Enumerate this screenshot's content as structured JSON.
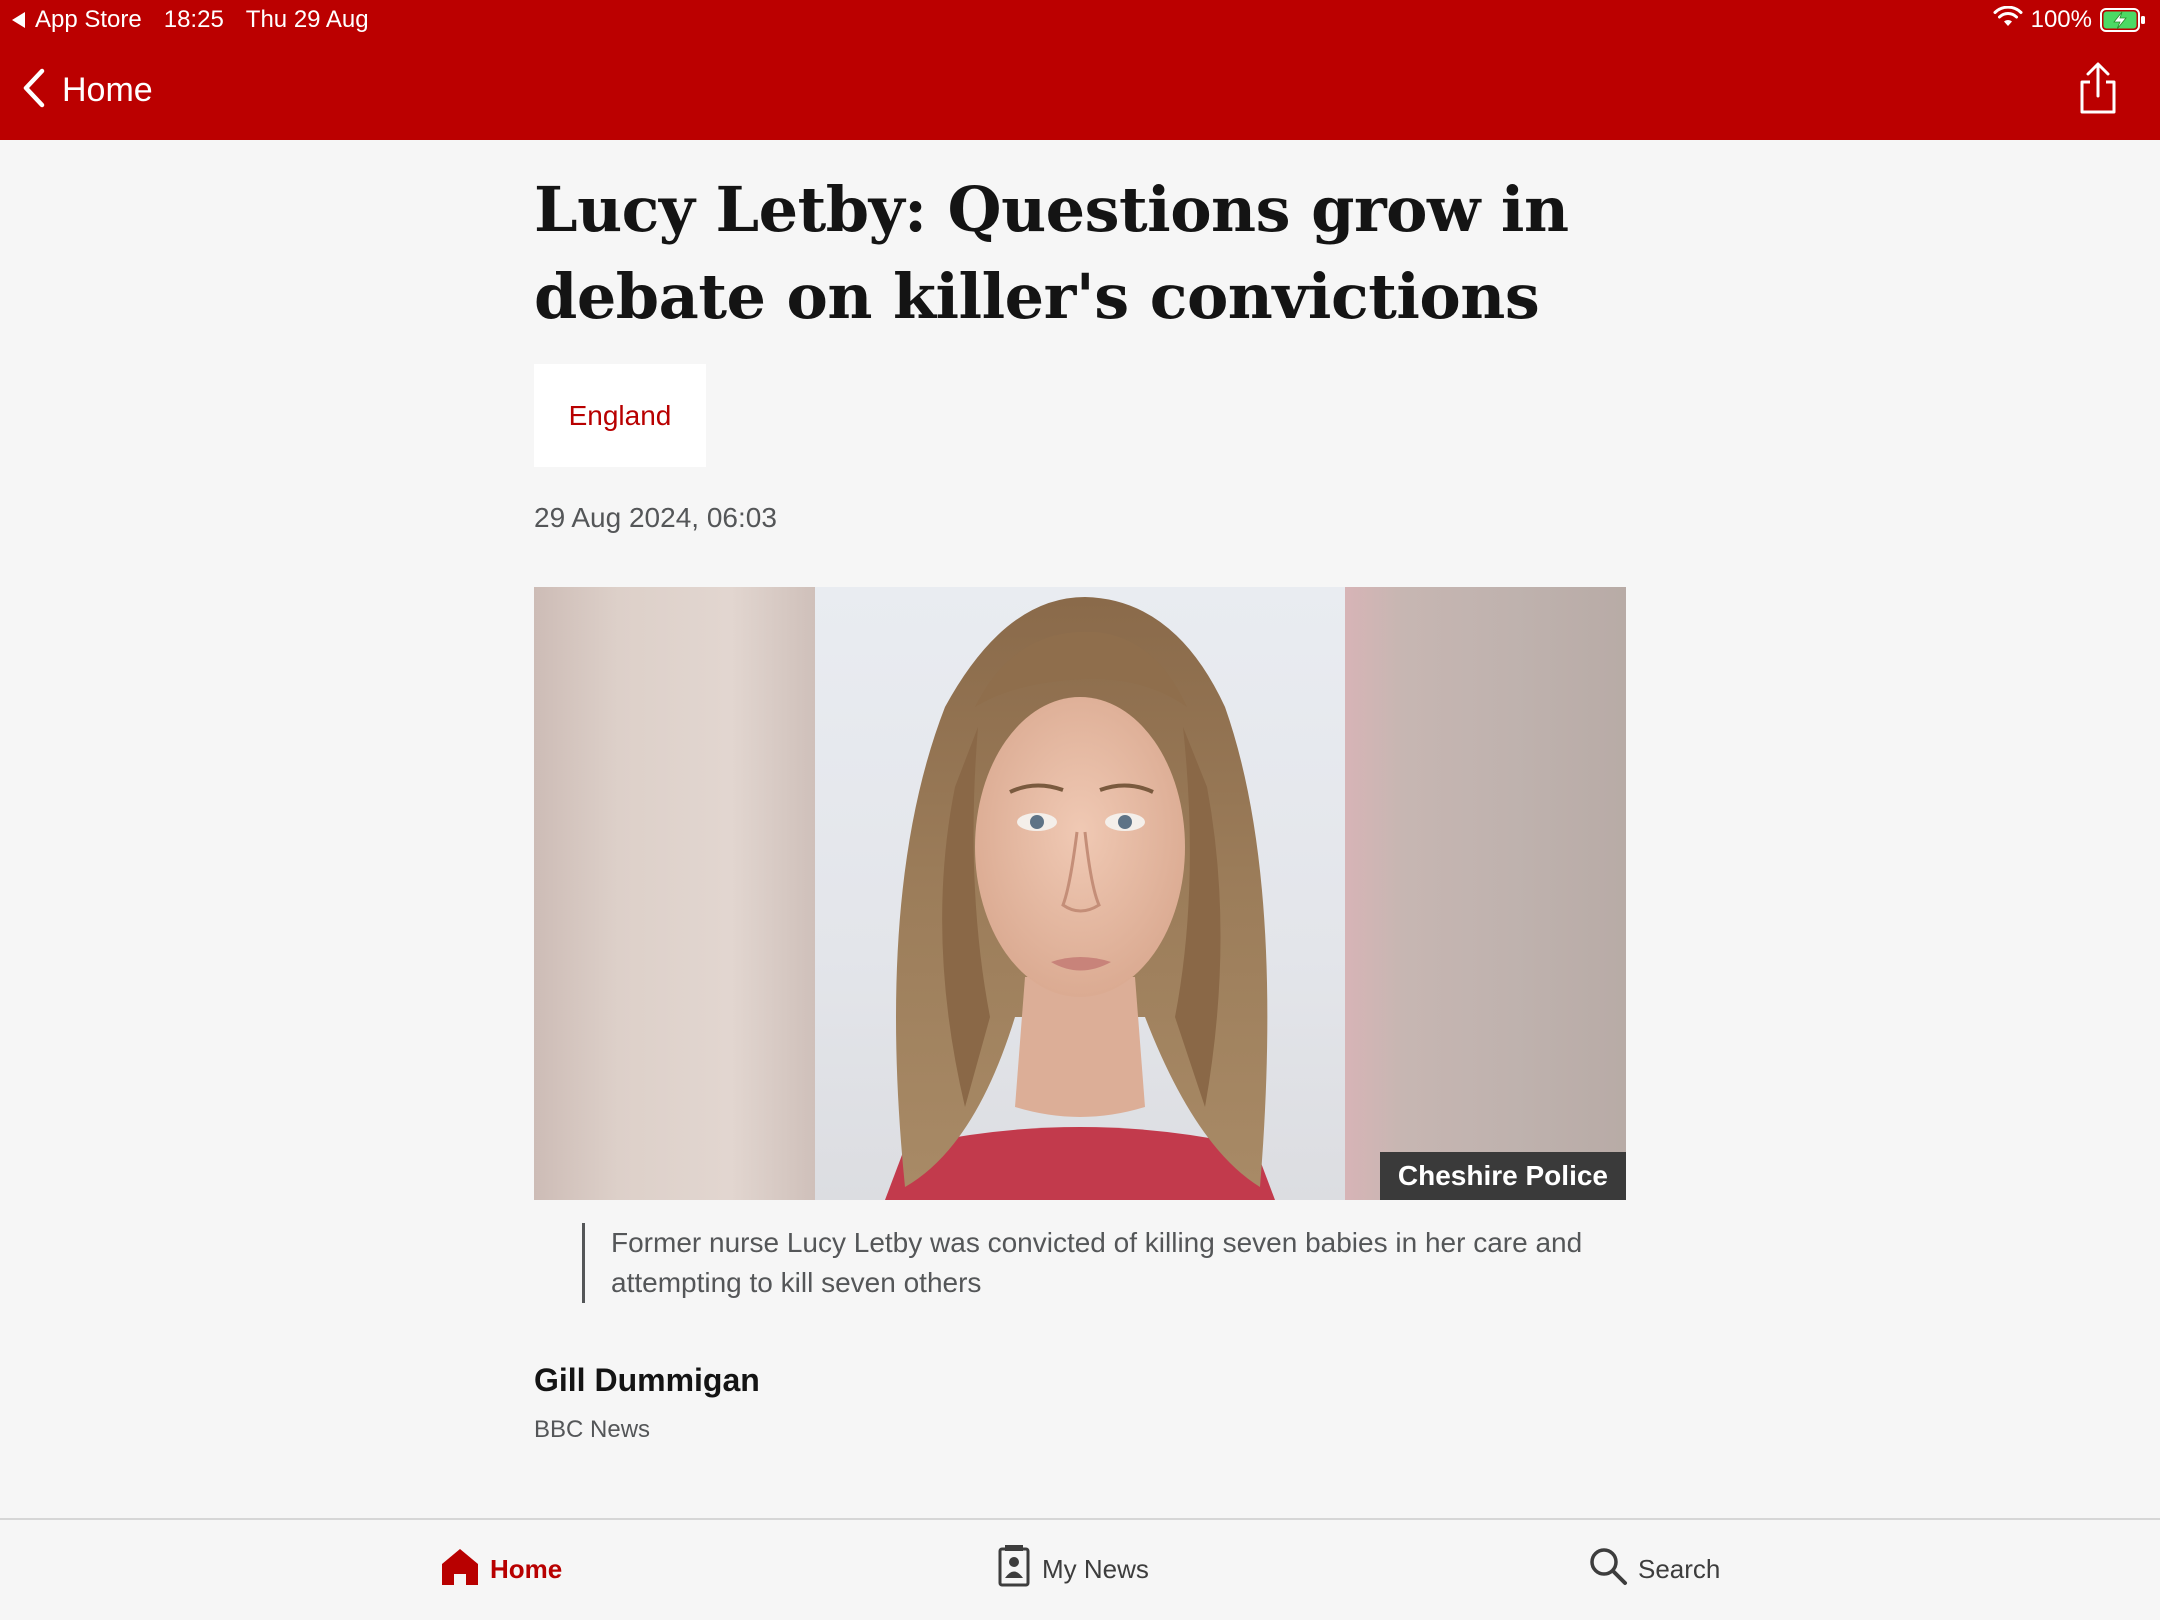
{
  "status_bar": {
    "back_app": "App Store",
    "time": "18:25",
    "date": "Thu 29 Aug",
    "battery_percent": "100%",
    "battery_level": 1.0,
    "charging": true
  },
  "nav": {
    "back_label": "Home",
    "share_icon": "share-icon"
  },
  "article": {
    "headline": "Lucy Letby: Questions grow in debate on killer's convictions",
    "topic": "England",
    "timestamp": "29 Aug 2024, 06:03",
    "image": {
      "credit": "Cheshire Police",
      "caption": "Former nurse Lucy Letby was convicted of killing seven babies in her care and attempting to kill seven others"
    },
    "byline": {
      "author": "Gill Dummigan",
      "organisation": "BBC News"
    }
  },
  "tabbar": {
    "tabs": [
      {
        "label": "Home",
        "icon": "home-icon",
        "active": true
      },
      {
        "label": "My News",
        "icon": "my-news-icon",
        "active": false
      },
      {
        "label": "Search",
        "icon": "search-icon",
        "active": false
      }
    ]
  },
  "colors": {
    "brand_red": "#bb0000",
    "topic_red": "#b80000",
    "background": "#f6f6f6",
    "battery_green": "#4cd964"
  }
}
